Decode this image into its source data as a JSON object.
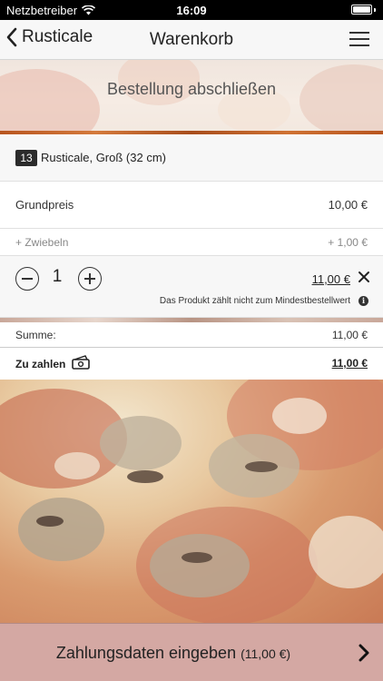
{
  "status_bar": {
    "carrier": "Netzbetreiber",
    "time": "16:09"
  },
  "nav": {
    "back_label": "Rusticale",
    "title": "Warenkorb"
  },
  "hero": {
    "title": "Bestellung abschließen"
  },
  "cart": {
    "item": {
      "number": "13",
      "name": "Rusticale, Groß (32 cm)"
    },
    "base_price": {
      "label": "Grundpreis",
      "value": "10,00 €"
    },
    "extra": {
      "label": "+ Zwiebeln",
      "value": "+ 1,00 €"
    },
    "quantity": "1",
    "line_total": "11,00 €",
    "notice": "Das Produkt zählt nicht zum Mindestbestellwert"
  },
  "totals": {
    "sum_label": "Summe:",
    "sum_value": "11,00 €",
    "pay_label": "Zu zahlen",
    "pay_value": "11,00 €"
  },
  "cta": {
    "label": "Zahlungsdaten eingeben",
    "amount": "(11,00 €)"
  },
  "icons": {
    "back": "chevron-left-icon",
    "menu": "hamburger-menu-icon",
    "wifi": "wifi-icon",
    "battery": "battery-icon",
    "minus": "minus-circle-icon",
    "plus": "plus-circle-icon",
    "remove": "close-icon",
    "info": "info-icon",
    "money": "money-icon",
    "forward": "chevron-right-icon"
  },
  "colors": {
    "cta_background": "#d4a8a3",
    "nav_background": "#f7f7f7"
  }
}
